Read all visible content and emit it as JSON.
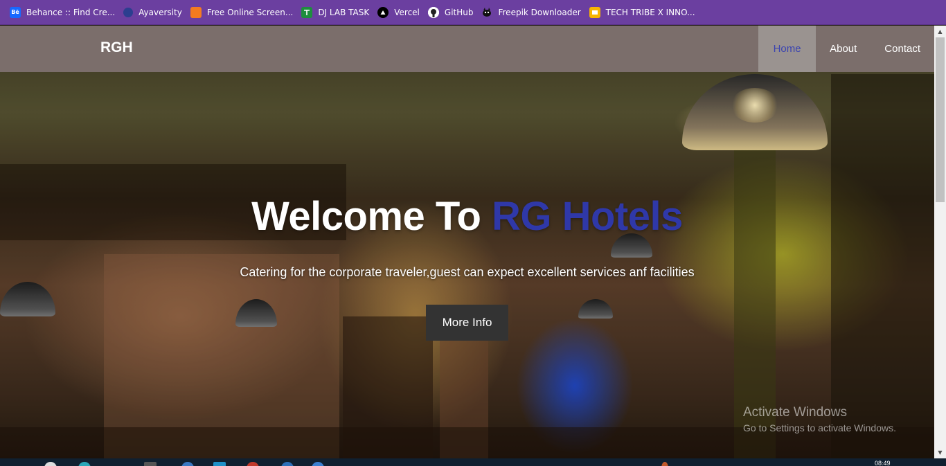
{
  "bookmarks": [
    {
      "label": "Behance :: Find Cre...",
      "icon": "behance-icon",
      "icon_text": "Bē"
    },
    {
      "label": "Ayaversity",
      "icon": "ayaversity-icon",
      "icon_text": ""
    },
    {
      "label": "Free Online Screen...",
      "icon": "screen-recorder-icon",
      "icon_text": ""
    },
    {
      "label": "DJ LAB TASK",
      "icon": "sheets-icon",
      "icon_text": ""
    },
    {
      "label": "Vercel",
      "icon": "vercel-icon",
      "icon_text": "▲"
    },
    {
      "label": "GitHub",
      "icon": "github-icon",
      "icon_text": ""
    },
    {
      "label": "Freepik Downloader",
      "icon": "freepik-icon",
      "icon_text": ""
    },
    {
      "label": "TECH TRIBE X INNO...",
      "icon": "slides-icon",
      "icon_text": ""
    }
  ],
  "navbar": {
    "brand": "RGH",
    "links": [
      {
        "label": "Home",
        "active": true
      },
      {
        "label": "About",
        "active": false
      },
      {
        "label": "Contact",
        "active": false
      }
    ]
  },
  "hero": {
    "title_prefix": "Welcome To ",
    "title_accent": "RG Hotels",
    "subtitle": "Catering for the corporate traveler,guest can expect excellent services anf facilities",
    "cta_label": "More Info"
  },
  "watermark": {
    "title": "Activate Windows",
    "subtitle": "Go to Settings to activate Windows."
  },
  "taskbar": {
    "clock": "08:49"
  },
  "colors": {
    "bookmarks_bg": "#6b3fa0",
    "navbar_bg": "#7b6e6b",
    "accent": "#2f38a8",
    "cta_bg": "#333333"
  }
}
